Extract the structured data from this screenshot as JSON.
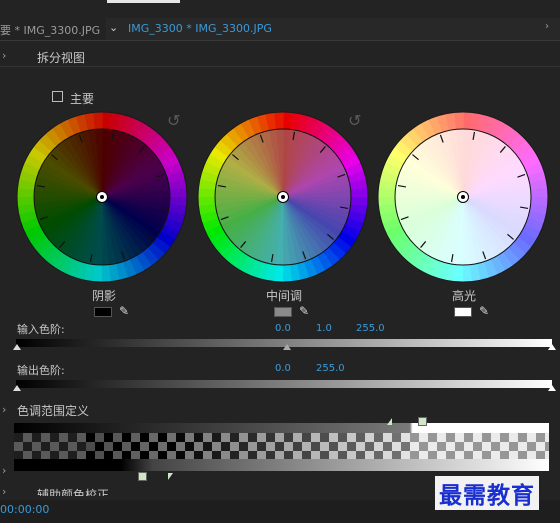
{
  "tabs": {
    "left_tab": "要 * IMG_3300.JPG",
    "active_tab": "IMG_3300 * IMG_3300.JPG",
    "active_chevron": "⌄",
    "scroll_arrow": "›"
  },
  "section_cut_label": "",
  "split_view": {
    "label": "拆分视图"
  },
  "master": {
    "label": "主要"
  },
  "wheels": [
    {
      "label": "阴影",
      "swatch": "#000000"
    },
    {
      "label": "中间调",
      "swatch": "#8a8a8a"
    },
    {
      "label": "高光",
      "swatch": "#ffffff"
    }
  ],
  "input_levels": {
    "label": "输入色阶:",
    "low": "0.0",
    "mid": "1.0",
    "high": "255.0"
  },
  "output_levels": {
    "label": "输出色阶:",
    "low": "0.0",
    "high": "255.0"
  },
  "hue_range": {
    "label": "色调范围定义"
  },
  "cut_row_1": "",
  "cut_row_2": "辅助颜色校正",
  "timecode": "00:00:00",
  "watermark": "最需教育",
  "colors": {
    "accent": "#3a9ad9",
    "background": "#232323",
    "watermark": "#1a2fd0"
  },
  "icons": [
    "chevron-right-icon",
    "reset-icon",
    "eyedropper-icon",
    "checkbox-icon"
  ]
}
